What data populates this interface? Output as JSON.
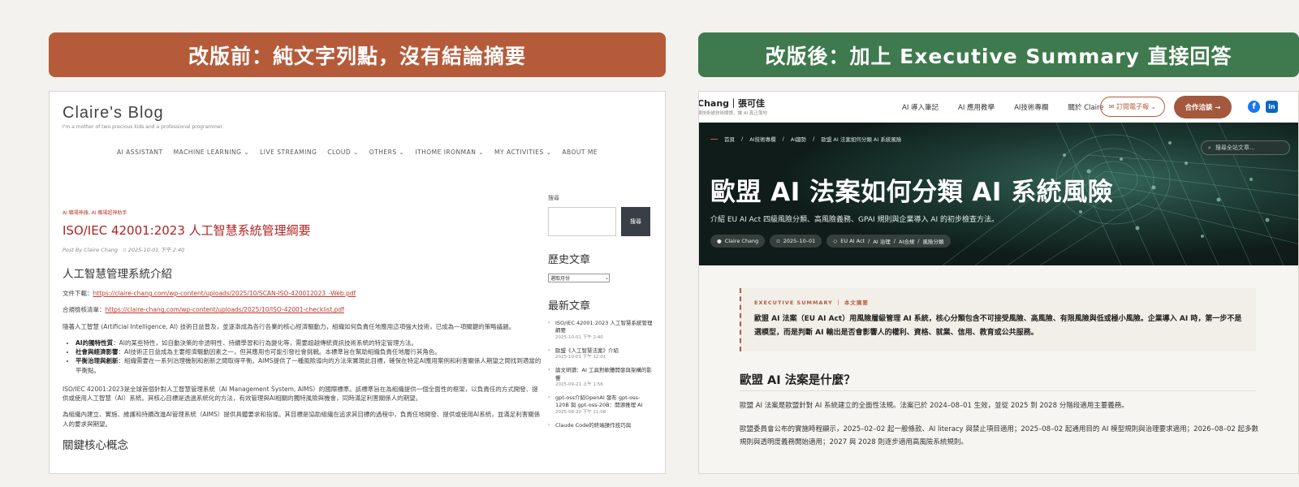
{
  "banners": {
    "left": "改版前：純文字列點，沒有結論摘要",
    "right": "改版後：加上 Executive Summary 直接回答"
  },
  "old": {
    "site_title": "Claire's Blog",
    "tagline": "I'm a mother of two precious kids and a professional programmer.",
    "nav": [
      "AI ASSISTANT",
      "MACHINE LEARNING ⌄",
      "LIVE STREAMING",
      "CLOUD ⌄",
      "OTHERS ⌄",
      "ITHOME IRONMAN ⌄",
      "MY ACTIVITIES ⌄",
      "ABOUT ME"
    ],
    "category": "AI 職場神器, AI 職場超神助手",
    "post_title": "ISO/IEC 42001:2023 人工智慧系統管理綱要",
    "post_by": "Post By",
    "author": "Claire Chang",
    "date": "2025-10-01 下午 2:40",
    "h2_intro": "人工智慧管理系統介紹",
    "download_label": "文件下載：",
    "download_link": "https://claire-chang.com/wp-content/uploads/2025/10/SCAN-ISO-420012023_-Web.pdf",
    "checklist_label": "合規檢核清單：",
    "checklist_link": "https://claire-chang.com/wp-content/uploads/2025/10/ISO-42001-checklist.pdf",
    "para1": "隨著人工智慧 (Artificial Intelligence, AI) 技術日益普及，並逐漸成為各行各業的核心經濟驅動力，組織如何負責任地應用這項強大技術，已成為一項關鍵的策略議題。",
    "bullets": [
      {
        "bold": "AI的獨特性質",
        "text": "：AI的某些特性，如自動決策的非透明性、持續學習和行為變化等，需要超越傳統資訊技術系統的特定管理方法。"
      },
      {
        "bold": "社會與經濟影響",
        "text": "：AI技術正日益成為主要經濟驅動因素之一，但其應用也可能引發社會挑戰。本標準旨在幫助組織負責任地履行其角色。"
      },
      {
        "bold": "平衡治理與創新",
        "text": "：組織需要在一系列治理機制和創新之間取得平衡。AIMS提供了一種風險導向的方法來實現此目標，確保在特定AI應用案例和利害關係人期望之間找到適當的平衡點。"
      }
    ],
    "para2": "ISO/IEC 42001:2023是全球首個針對人工智慧管理系統（AI Management System, AIMS）的國際標準。該標準旨在為組織提供一個全面性的框架，以負責任的方式開發、提供或使用人工智慧（AI）系統。其核心目標是透過系統化的方法，有效管理與AI相關的獨特風險與機會，同時滿足利害關係人的期望。",
    "para3": "為組織內建立、實施、維護和持續改進AI管理系統（AIMS）提供具體要求和指導。其目標是協助組織在追求其目標的過程中，負責任地開發、提供或使用AI系統，並滿足利害關係人的要求與期望。",
    "h2_concepts": "關鍵核心概念",
    "sidebar": {
      "search_label": "搜尋",
      "search_button": "搜尋",
      "archive_title": "歷史文章",
      "archive_select": "選取月份",
      "recent_title": "最新文章",
      "recent": [
        {
          "title": "ISO/IEC 42001:2023 人工智慧系統管理綱要",
          "date": "2025-10-01 下午 2:40"
        },
        {
          "title": "歐盟《人工智慧法案》介紹",
          "date": "2025-10-01 下午 12:01"
        },
        {
          "title": "論文研讀：AI 工具對軟體開發與架構的影響",
          "date": "2025-09-21 上午 1:56"
        },
        {
          "title": "gpt-oss介紹OpenAI 發布 gpt-oss-120B 與 gpt-oss-20B：開源推理 AI",
          "date": "2025-08-20 下午 11:08"
        },
        {
          "title": "Claude Code的終端操作技巧與",
          "date": ""
        }
      ]
    }
  },
  "new": {
    "logo": "Chang｜張可佳",
    "logo_sub": "讓技術被技術關懷，讓 AI 真正落地",
    "nav": [
      "AI 導入筆記",
      "AI 應用教學",
      "AI技術專欄",
      "關於 Claire"
    ],
    "subscribe": "✉ 訂閱電子報 ⌄",
    "collab": "合作洽談 →",
    "breadcrumb": [
      "首頁",
      "AI技術專欄",
      "AI趨勢",
      "歐盟 AI 法案如何分類 AI 系統風險"
    ],
    "search_placeholder": "搜尋全站文章...",
    "hero_title": "歐盟 AI 法案如何分類 AI 系統風險",
    "hero_desc": "介紹 EU AI Act 四級風險分類、高風險義務、GPAI 規則與企業導入 AI 的初步檢查方法。",
    "tags": [
      "Claire Chang",
      "2025–10–01",
      "EU AI Act",
      "AI 治理",
      "AI合規",
      "風險分類"
    ],
    "exec_label": "EXECUTIVE SUMMARY ｜ 本文摘要",
    "exec_text": "歐盟 AI 法案（EU AI Act）用風險層級管理 AI 系統，核心分類包含不可接受風險、高風險、有限風險與低或極小風險。企業導入 AI 時，第一步不是選模型，而是判斷 AI 輸出是否會影響人的權利、資格、就業、信用、教育或公共服務。",
    "h2": "歐盟 AI 法案是什麼？",
    "p1": "歐盟 AI 法案是歐盟針對 AI 系統建立的全面性法規。法案已於 2024–08–01 生效，並從 2025 到 2028 分階段適用主要義務。",
    "p2": "歐盟委員會公布的實施時程顯示，2025–02–02 起一般條款、AI literacy 與禁止項目適用；2025–08–02 起通用目的 AI 模型規則與治理要求適用；2026–08–02 起多數規則與透明度義務開始適用；2027 與 2028 則逐步適用高風險系統規則。"
  }
}
